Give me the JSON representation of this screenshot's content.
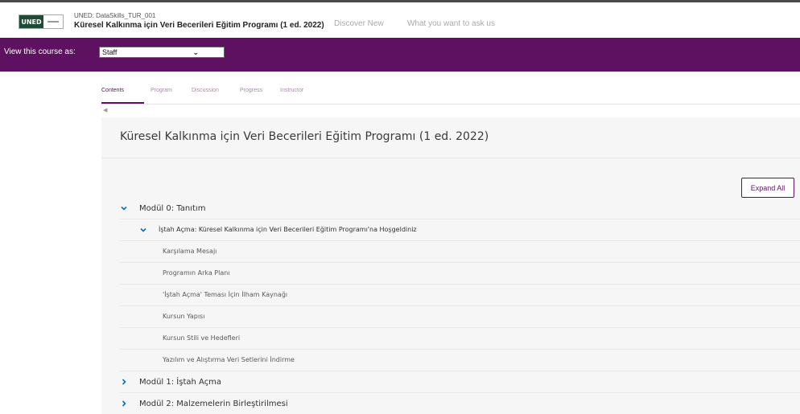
{
  "header": {
    "logo_text": "UNED",
    "course_id": "UNED: DataSkills_TUR_001",
    "course_name": "Küresel Kalkınma için Veri Becerileri Eğitim Programı (1 ed. 2022)",
    "links": [
      "Discover New",
      "What you want to ask us"
    ]
  },
  "staff_bar": {
    "label": "View this course as:",
    "selected": "Staff"
  },
  "tabs": [
    "Contents",
    "Program",
    "Discussion",
    "Progress",
    "Instructor"
  ],
  "active_tab": "Contents",
  "course": {
    "title": "Küresel Kalkınma için Veri Becerileri Eğitim Programı (1 ed. 2022)",
    "expand_all": "Expand All",
    "sections": [
      {
        "title": "Modül 0: Tanıtım",
        "expanded": true
      },
      {
        "title": "Modül 1: İştah Açma",
        "expanded": false
      },
      {
        "title": "Modül 2: Malzemelerin Birleştirilmesi",
        "expanded": false
      }
    ],
    "subsection": "İştah Açma: Küresel Kalkınma için Veri Becerileri Eğitim Programı'na Hoşgeldiniz",
    "units": [
      "Karşılama Mesajı",
      "Programın Arka Planı",
      "'İştah Açma' Teması İçin İlham Kaynağı",
      "Kursun Yapısı",
      "Kursun Stili ve Hedefleri",
      "Yazılım ve Alıştırma Veri Setlerini İndirme"
    ]
  },
  "colors": {
    "brand_purple": "#5e1160",
    "chevron_blue": "#0075b4",
    "logo_green": "#1d4d37"
  },
  "icons": {
    "expanded": "chevron-down-icon",
    "collapsed": "chevron-right-icon",
    "select_arrow": "chevron-down-icon",
    "back": "caret-left-icon"
  }
}
